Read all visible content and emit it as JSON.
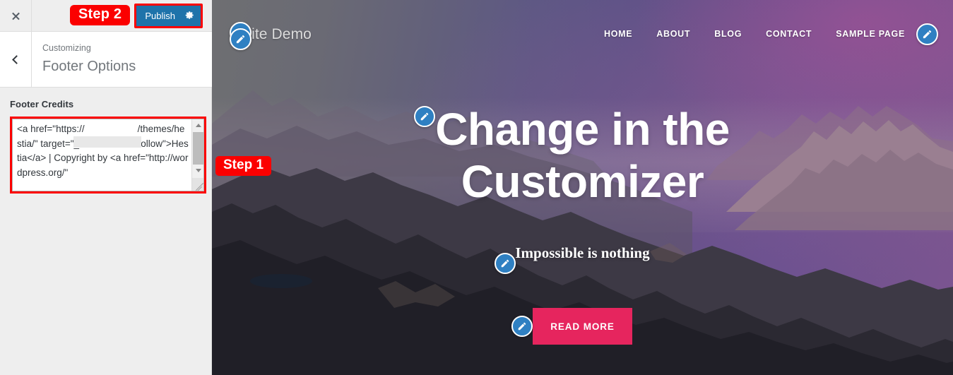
{
  "sidebar": {
    "close_label": "Close customizer",
    "back_label": "Back",
    "step2_badge": "Step 2",
    "publish_label": "Publish",
    "gear_icon": "gear-icon",
    "breadcrumb": "Customizing",
    "panel_title": "Footer Options",
    "field_label": "Footer Credits",
    "footer_credits_value": "<a href=\"https://                    /themes/hestia/\" target=\"_blank\" rel=\"nofollow\">Hestia</a> | Copyright by <a href=\"http://wordpress.org/\"",
    "redacted_note": "redacted-url-block"
  },
  "preview": {
    "site_title": "Site Demo",
    "nav": [
      {
        "label": "HOME"
      },
      {
        "label": "ABOUT"
      },
      {
        "label": "BLOG"
      },
      {
        "label": "CONTACT"
      },
      {
        "label": "SAMPLE PAGE"
      }
    ],
    "hero": {
      "title_line1": "Change in the",
      "title_line2": "Customizer",
      "subtitle": "Impossible is nothing",
      "button_label": "READ MORE"
    },
    "step1_badge": "Step 1",
    "edit_shortcuts": [
      {
        "name": "edit-shortcut-logo"
      },
      {
        "name": "edit-shortcut-site-title"
      },
      {
        "name": "edit-shortcut-nav-menu"
      },
      {
        "name": "edit-shortcut-hero-title"
      },
      {
        "name": "edit-shortcut-hero-subtitle"
      },
      {
        "name": "edit-shortcut-hero-button"
      }
    ]
  },
  "colors": {
    "publish_blue": "#1e73aa",
    "annotation_red": "#fb0000",
    "cta_pink": "#e6255e",
    "pencil_blue": "#2f80c2",
    "sidebar_bg": "#eeeeee"
  }
}
